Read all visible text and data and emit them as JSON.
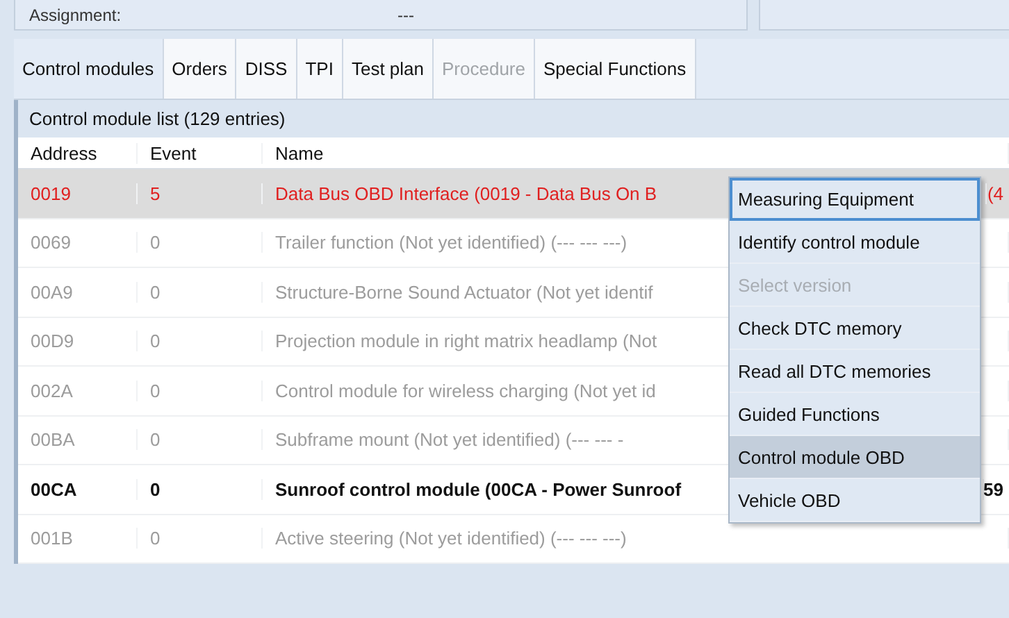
{
  "assignment": {
    "label": "Assignment:",
    "value": "---"
  },
  "tabs": [
    {
      "label": "Control modules",
      "selected": true,
      "disabled": false
    },
    {
      "label": "Orders",
      "selected": false,
      "disabled": false
    },
    {
      "label": "DISS",
      "selected": false,
      "disabled": false
    },
    {
      "label": "TPI",
      "selected": false,
      "disabled": false
    },
    {
      "label": "Test plan",
      "selected": false,
      "disabled": false
    },
    {
      "label": "Procedure",
      "selected": false,
      "disabled": true
    },
    {
      "label": "Special Functions",
      "selected": false,
      "disabled": false
    }
  ],
  "list": {
    "title": "Control module list (129 entries)",
    "columns": [
      "Address",
      "Event",
      "Name"
    ],
    "rows": [
      {
        "address": "0019",
        "event": "5",
        "name": "Data Bus OBD Interface (0019 - Data Bus On B",
        "name_tail": "(4",
        "kind": "fault",
        "selected": true
      },
      {
        "address": "0069",
        "event": "0",
        "name": "Trailer function (Not yet identified) (---   ---   ---)",
        "kind": "unidentified",
        "selected": false
      },
      {
        "address": "00A9",
        "event": "0",
        "name": "Structure-Borne Sound Actuator (Not yet identif",
        "kind": "unidentified",
        "selected": false
      },
      {
        "address": "00D9",
        "event": "0",
        "name": "Projection module in right matrix headlamp (Not",
        "kind": "unidentified",
        "selected": false
      },
      {
        "address": "002A",
        "event": "0",
        "name": "Control module for wireless charging (Not yet id",
        "kind": "unidentified",
        "selected": false
      },
      {
        "address": "00BA",
        "event": "0",
        "name": "Subframe mount (Not yet identified) (---   ---   -",
        "kind": "unidentified",
        "selected": false
      },
      {
        "address": "00CA",
        "event": "0",
        "name": "Sunroof control module (00CA - Power Sunroof",
        "name_tail": "59",
        "kind": "identified",
        "selected": false
      },
      {
        "address": "001B",
        "event": "0",
        "name": "Active steering (Not yet identified) (---   ---   ---)",
        "kind": "unidentified",
        "selected": false
      }
    ]
  },
  "context_menu": [
    {
      "label": "Measuring Equipment",
      "focused": true,
      "selected": false,
      "disabled": false
    },
    {
      "label": "Identify control module",
      "focused": false,
      "selected": false,
      "disabled": false
    },
    {
      "label": "Select version",
      "focused": false,
      "selected": false,
      "disabled": true
    },
    {
      "label": "Check DTC memory",
      "focused": false,
      "selected": false,
      "disabled": false
    },
    {
      "label": "Read all DTC memories",
      "focused": false,
      "selected": false,
      "disabled": false
    },
    {
      "label": "Guided Functions",
      "focused": false,
      "selected": false,
      "disabled": false
    },
    {
      "label": "Control module OBD",
      "focused": false,
      "selected": true,
      "disabled": false
    },
    {
      "label": "Vehicle OBD",
      "focused": false,
      "selected": false,
      "disabled": false
    }
  ]
}
